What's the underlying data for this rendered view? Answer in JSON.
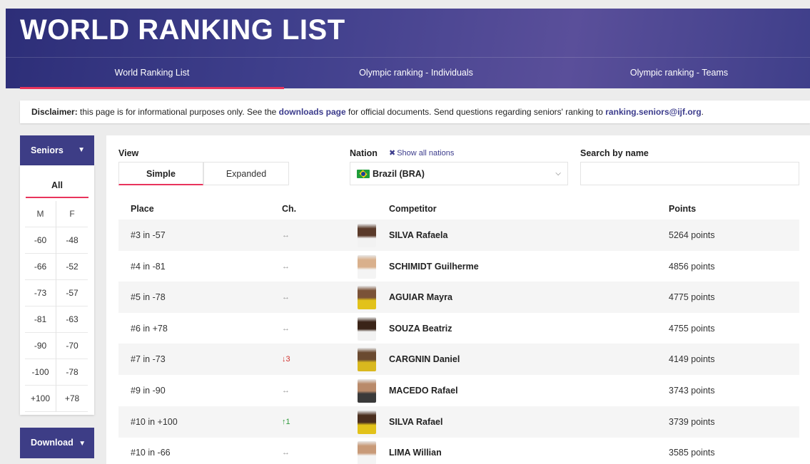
{
  "header": {
    "title": "WORLD RANKING LIST",
    "tabs": [
      {
        "label": "World Ranking List",
        "active": true
      },
      {
        "label": "Olympic ranking - Individuals",
        "active": false
      },
      {
        "label": "Olympic ranking - Teams",
        "active": false
      }
    ]
  },
  "disclaimer": {
    "prefix": "Disclaimer:",
    "text1": " this page is for informational purposes only. See the ",
    "link1": "downloads page",
    "text2": " for official documents. Send questions regarding seniors' ranking to ",
    "link2": "ranking.seniors@ijf.org",
    "text3": "."
  },
  "sidebar": {
    "category": "Seniors",
    "all": "All",
    "men_header": "M",
    "women_header": "F",
    "men": [
      "-60",
      "-66",
      "-73",
      "-81",
      "-90",
      "-100",
      "+100"
    ],
    "women": [
      "-48",
      "-52",
      "-57",
      "-63",
      "-70",
      "-78",
      "+78"
    ],
    "download": "Download"
  },
  "filters": {
    "view_label": "View",
    "view_simple": "Simple",
    "view_expanded": "Expanded",
    "nation_label": "Nation",
    "show_all": "Show all nations",
    "nation_value": "Brazil (BRA)",
    "search_label": "Search by name",
    "search_value": ""
  },
  "table": {
    "headers": {
      "place": "Place",
      "change": "Ch.",
      "competitor": "Competitor",
      "points": "Points"
    },
    "rows": [
      {
        "place": "#3 in -57",
        "change": "↔",
        "trend": "same",
        "name": "SILVA Rafaela",
        "points": "5264 points",
        "photo": [
          "#5a3a2a",
          "#f2f2f2"
        ]
      },
      {
        "place": "#4 in -81",
        "change": "↔",
        "trend": "same",
        "name": "SCHIMIDT Guilherme",
        "points": "4856 points",
        "photo": [
          "#d9b08c",
          "#f4f4f4"
        ]
      },
      {
        "place": "#5 in -78",
        "change": "↔",
        "trend": "same",
        "name": "AGUIAR Mayra",
        "points": "4775 points",
        "photo": [
          "#7a5238",
          "#e2c21a"
        ]
      },
      {
        "place": "#6 in +78",
        "change": "↔",
        "trend": "same",
        "name": "SOUZA Beatriz",
        "points": "4755 points",
        "photo": [
          "#3a2418",
          "#f2f2f2"
        ]
      },
      {
        "place": "#7 in -73",
        "change": "↓3",
        "trend": "down",
        "name": "CARGNIN Daniel",
        "points": "4149 points",
        "photo": [
          "#6a4a30",
          "#d9b81e"
        ]
      },
      {
        "place": "#9 in -90",
        "change": "↔",
        "trend": "same",
        "name": "MACEDO Rafael",
        "points": "3743 points",
        "photo": [
          "#b98a6a",
          "#3a3a3a"
        ]
      },
      {
        "place": "#10 in +100",
        "change": "↑1",
        "trend": "up",
        "name": "SILVA Rafael",
        "points": "3739 points",
        "photo": [
          "#4a2e1e",
          "#e2c21a"
        ]
      },
      {
        "place": "#10 in -66",
        "change": "↔",
        "trend": "same",
        "name": "LIMA Willian",
        "points": "3585 points",
        "photo": [
          "#c89a78",
          "#f4f4f4"
        ]
      }
    ]
  },
  "colors": {
    "brand": "#3d3d86",
    "accent": "#e8345c",
    "link": "#3c3c8c",
    "down": "#d0312d",
    "up": "#2e9a3a"
  },
  "icons": {
    "dropdown": "caret-down-icon",
    "close": "x-icon",
    "flag": "brazil-flag-icon",
    "select": "chevron-down-icon"
  }
}
